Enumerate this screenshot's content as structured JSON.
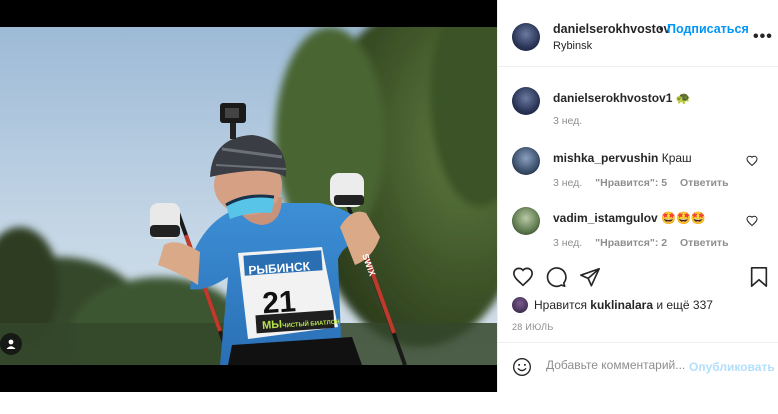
{
  "post": {
    "author": "danielserokhvostov1",
    "author_display": "danielserokhvostov",
    "follow_label": "Подписаться",
    "separator": "•",
    "location": "Rybinsk",
    "more_label": "•••"
  },
  "caption": {
    "username": "danielserokhvostov1",
    "emoji": "🐢",
    "time": "3 нед."
  },
  "comments": [
    {
      "username": "mishka_pervushin",
      "text": "Краш",
      "time": "3 нед.",
      "likes": "\"Нравится\": 5",
      "reply_label": "Ответить"
    },
    {
      "username": "vadim_istamgulov",
      "text": "🤩🤩🤩",
      "time": "3 нед.",
      "likes": "\"Нравится\": 2",
      "reply_label": "Ответить"
    }
  ],
  "likes_summary": {
    "prefix": "Нравится",
    "user": "kuklinalara",
    "suffix": "и ещё 337"
  },
  "post_date": "28 ИЮЛЬ",
  "composer": {
    "placeholder": "Добавьте комментарий...",
    "post_label": "Опубликовать"
  },
  "photo": {
    "bib_city": "РЫБИНСК",
    "bib_number": "21",
    "bib_sponsor": "ЧИСТЫЙ БИАТЛОН",
    "pole_brand": "SWIX",
    "bib_prefix": "МЫ"
  },
  "colors": {
    "accent": "#0095f6",
    "post_disabled": "#b2dffc",
    "muted": "#8e8e8e",
    "text": "#262626"
  }
}
